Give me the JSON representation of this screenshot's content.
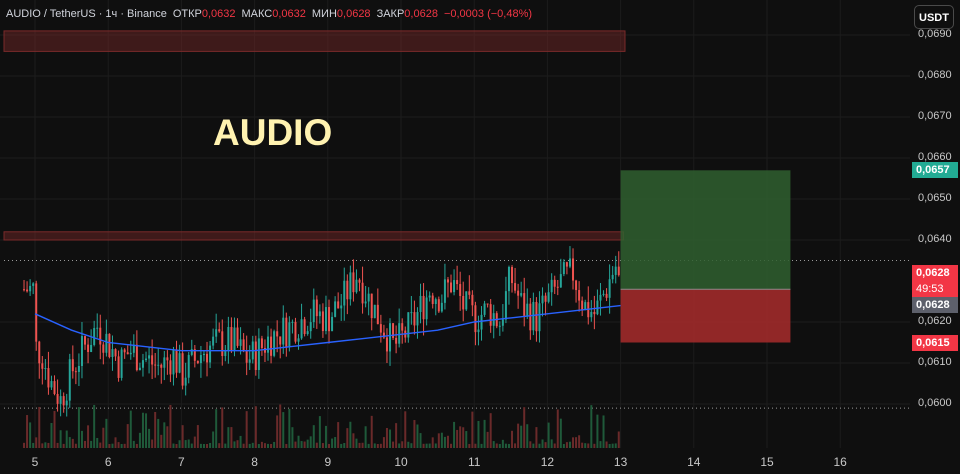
{
  "header": {
    "symbol": "AUDIO / TetherUS · 1ч · Binance",
    "open_label": "ОТКР",
    "open": "0,0632",
    "high_label": "МАКС",
    "high": "0,0632",
    "low_label": "МИН",
    "low": "0,0628",
    "close_label": "ЗАКР",
    "close": "0,0628",
    "change": "−0,0003 (−0,48%)"
  },
  "currency_button": "USDT",
  "watermark": "AUDIO",
  "price_labels": {
    "target": "0,0657",
    "current": "0,0628",
    "countdown": "49:53",
    "entry": "0,0628",
    "stop": "0,0615"
  },
  "colors": {
    "background": "#0f0f0f",
    "up": "#26a69a",
    "down": "#ef5350",
    "ma": "#2962ff",
    "profit_zone": "#2f5f2f",
    "loss_zone": "#a02a2a",
    "target_label": "#22ab94",
    "stop_label": "#f23645",
    "entry_label": "#5d606b"
  },
  "chart_data": {
    "type": "candlestick",
    "title": "AUDIO / TetherUS · 1ч · Binance",
    "x_tick_labels": [
      "5",
      "6",
      "7",
      "8",
      "9",
      "10",
      "11",
      "12",
      "13",
      "14",
      "15",
      "16"
    ],
    "y_tick_labels": [
      "0,0690",
      "0,0680",
      "0,0670",
      "0,0660",
      "0,0650",
      "0,0640",
      "0,0620",
      "0,0610",
      "0,0600"
    ],
    "ylim": [
      0.0594,
      0.0692
    ],
    "last_price": 0.0628,
    "ohlc_last": {
      "open": 0.0632,
      "high": 0.0632,
      "low": 0.0628,
      "close": 0.0628
    },
    "position": {
      "type": "long",
      "entry": 0.0628,
      "target": 0.0657,
      "stop": 0.0615
    },
    "zones": [
      {
        "name": "resistance_upper",
        "from": 0.0686,
        "to": 0.0691
      },
      {
        "name": "resistance_mid",
        "from": 0.064,
        "to": 0.0642
      }
    ],
    "horizontal_lines": [
      0.0635,
      0.0599
    ],
    "price_path": [
      [
        5.0,
        0.0614
      ],
      [
        5.1,
        0.0612
      ],
      [
        5.2,
        0.0606
      ],
      [
        5.35,
        0.0601
      ],
      [
        5.5,
        0.0608
      ],
      [
        5.65,
        0.0613
      ],
      [
        5.85,
        0.0619
      ],
      [
        6.0,
        0.0615
      ],
      [
        6.15,
        0.061
      ],
      [
        6.3,
        0.0613
      ],
      [
        6.5,
        0.0611
      ],
      [
        6.7,
        0.0609
      ],
      [
        6.9,
        0.0612
      ],
      [
        7.0,
        0.0607
      ],
      [
        7.15,
        0.061
      ],
      [
        7.3,
        0.0613
      ],
      [
        7.5,
        0.0615
      ],
      [
        7.7,
        0.0615
      ],
      [
        7.9,
        0.0611
      ],
      [
        8.0,
        0.0612
      ],
      [
        8.2,
        0.0616
      ],
      [
        8.4,
        0.0618
      ],
      [
        8.6,
        0.062
      ],
      [
        8.8,
        0.0622
      ],
      [
        9.0,
        0.0621
      ],
      [
        9.2,
        0.0625
      ],
      [
        9.4,
        0.0632
      ],
      [
        9.55,
        0.0626
      ],
      [
        9.75,
        0.0619
      ],
      [
        9.9,
        0.0614
      ],
      [
        10.05,
        0.0617
      ],
      [
        10.2,
        0.0621
      ],
      [
        10.4,
        0.0628
      ],
      [
        10.55,
        0.0626
      ],
      [
        10.7,
        0.063
      ],
      [
        10.85,
        0.0624
      ],
      [
        11.0,
        0.0621
      ],
      [
        11.2,
        0.0623
      ],
      [
        11.35,
        0.062
      ],
      [
        11.5,
        0.0631
      ],
      [
        11.65,
        0.0624
      ],
      [
        11.85,
        0.0621
      ],
      [
        12.0,
        0.0625
      ],
      [
        12.2,
        0.063
      ],
      [
        12.35,
        0.0632
      ],
      [
        12.5,
        0.0624
      ],
      [
        12.65,
        0.0622
      ],
      [
        12.8,
        0.0628
      ],
      [
        12.93,
        0.0634
      ],
      [
        13.0,
        0.0628
      ]
    ],
    "ma_path": [
      [
        5.0,
        0.0622
      ],
      [
        5.5,
        0.0618
      ],
      [
        6.0,
        0.0615
      ],
      [
        6.5,
        0.0614
      ],
      [
        7.0,
        0.0613
      ],
      [
        7.5,
        0.0613
      ],
      [
        8.0,
        0.0613
      ],
      [
        8.5,
        0.0614
      ],
      [
        9.0,
        0.0615
      ],
      [
        9.5,
        0.0616
      ],
      [
        10.0,
        0.0617
      ],
      [
        10.5,
        0.0618
      ],
      [
        11.0,
        0.062
      ],
      [
        11.5,
        0.0621
      ],
      [
        12.0,
        0.0622
      ],
      [
        12.5,
        0.0623
      ],
      [
        13.0,
        0.0624
      ]
    ]
  }
}
